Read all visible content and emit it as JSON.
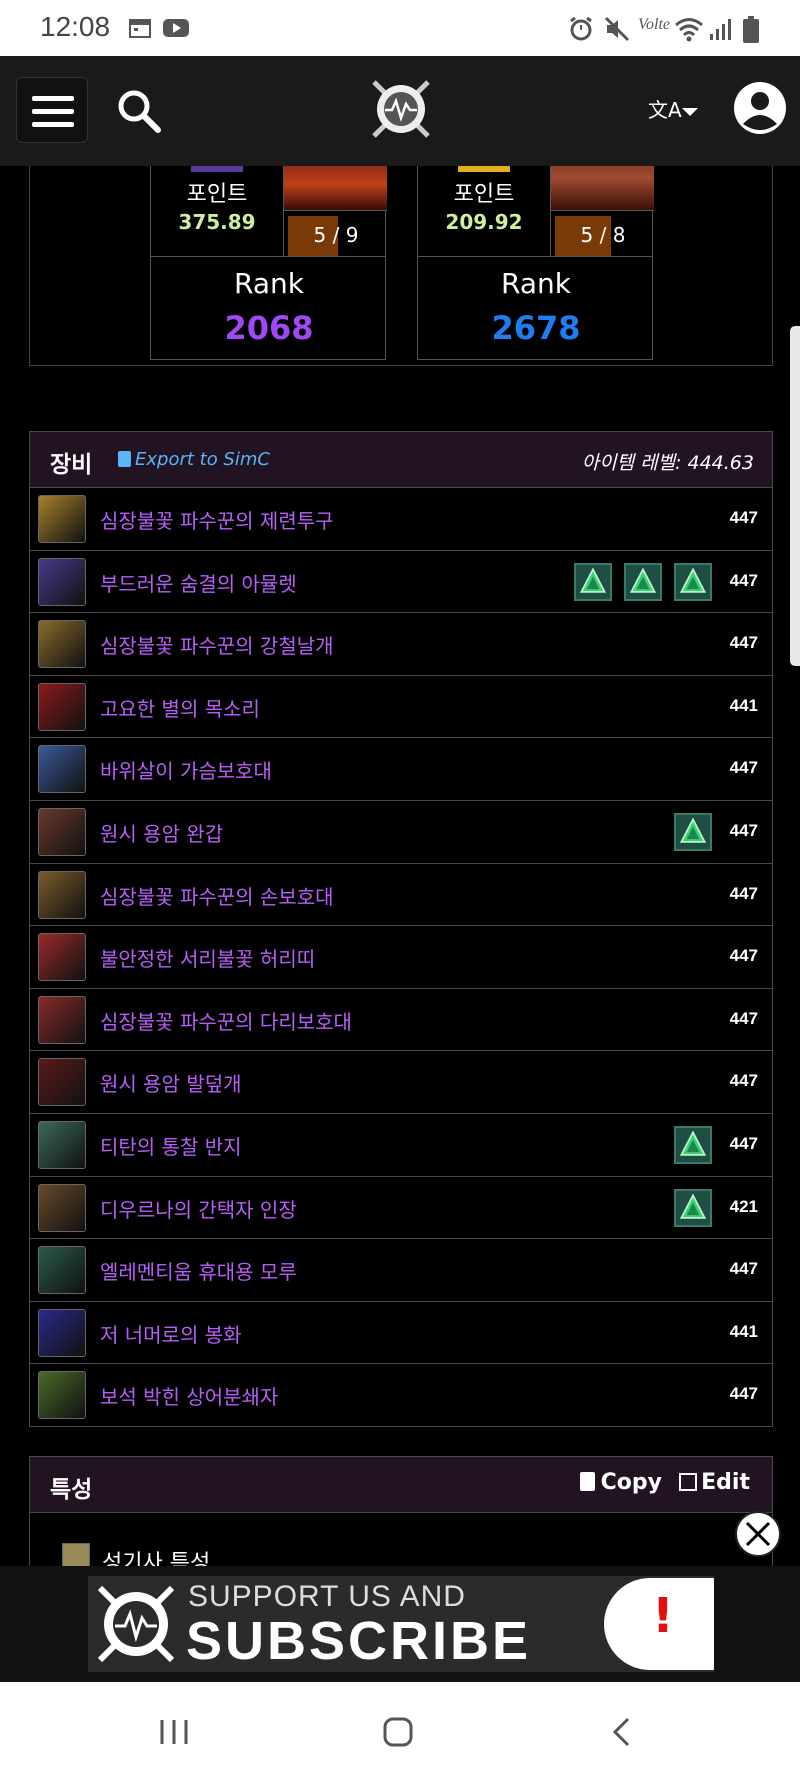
{
  "status_bar": {
    "time": "12:08",
    "left_icons": [
      "calendar-icon",
      "youtube-icon"
    ],
    "right_icons": [
      "alarm-icon",
      "mute-icon",
      "volte-icon",
      "wifi-icon",
      "signal-icon",
      "battery-icon"
    ]
  },
  "nav": {
    "icons": [
      "menu-icon",
      "search-icon",
      "site-logo",
      "translate-icon",
      "account-icon"
    ]
  },
  "ranks": [
    {
      "points_label": "포인트",
      "points": "375.89",
      "progress": "5 / 9",
      "rank_label": "Rank",
      "rank": "2068",
      "rank_color": "#a148f5"
    },
    {
      "points_label": "포인트",
      "points": "209.92",
      "progress": "5 / 8",
      "rank_label": "Rank",
      "rank": "2678",
      "rank_color": "#1f7df2"
    }
  ],
  "equipment": {
    "title": "장비",
    "export_label": "Export to SimC",
    "item_level_label": "아이템 레벨: 444.63",
    "items": [
      {
        "name": "심장불꽃 파수꾼의 제련투구",
        "ilvl": "447",
        "gems": 0,
        "icon_color": "#a8812a"
      },
      {
        "name": "부드러운 숨결의 아뮬렛",
        "ilvl": "447",
        "gems": 3,
        "icon_color": "#4a3a8a"
      },
      {
        "name": "심장불꽃 파수꾼의 강철날개",
        "ilvl": "447",
        "gems": 0,
        "icon_color": "#8a6a2a"
      },
      {
        "name": "고요한 별의 목소리",
        "ilvl": "441",
        "gems": 0,
        "icon_color": "#8a1a1a"
      },
      {
        "name": "바위살이 가슴보호대",
        "ilvl": "447",
        "gems": 0,
        "icon_color": "#3a5a9a"
      },
      {
        "name": "원시 용암 완갑",
        "ilvl": "447",
        "gems": 1,
        "icon_color": "#6a3a2a"
      },
      {
        "name": "심장불꽃 파수꾼의 손보호대",
        "ilvl": "447",
        "gems": 0,
        "icon_color": "#7a5a2a"
      },
      {
        "name": "불안정한 서리불꽃 허리띠",
        "ilvl": "447",
        "gems": 0,
        "icon_color": "#9a2a2a"
      },
      {
        "name": "심장불꽃 파수꾼의 다리보호대",
        "ilvl": "447",
        "gems": 0,
        "icon_color": "#8a2a2a"
      },
      {
        "name": "원시 용암 발덮개",
        "ilvl": "447",
        "gems": 0,
        "icon_color": "#5a1a1a"
      },
      {
        "name": "티탄의 통찰 반지",
        "ilvl": "447",
        "gems": 1,
        "icon_color": "#3a6a5a"
      },
      {
        "name": "디우르나의 간택자 인장",
        "ilvl": "421",
        "gems": 1,
        "icon_color": "#6a4a2a"
      },
      {
        "name": "엘레멘티움 휴대용 모루",
        "ilvl": "447",
        "gems": 0,
        "icon_color": "#2a5a4a"
      },
      {
        "name": "저 너머로의 봉화",
        "ilvl": "441",
        "gems": 0,
        "icon_color": "#2a2a8a"
      },
      {
        "name": "보석 박힌 상어분쇄자",
        "ilvl": "447",
        "gems": 0,
        "icon_color": "#4a6a2a"
      }
    ]
  },
  "talents": {
    "title": "특성",
    "copy_label": "Copy",
    "edit_label": "Edit",
    "class_talents_label": "성기사 특성"
  },
  "ad": {
    "line1": "SUPPORT US AND",
    "line2": "SUBSCRIBE",
    "alert": "!",
    "close_icon": "close-icon"
  },
  "bottom_nav": {
    "icons": [
      "recent-apps-icon",
      "home-icon",
      "back-icon"
    ]
  }
}
